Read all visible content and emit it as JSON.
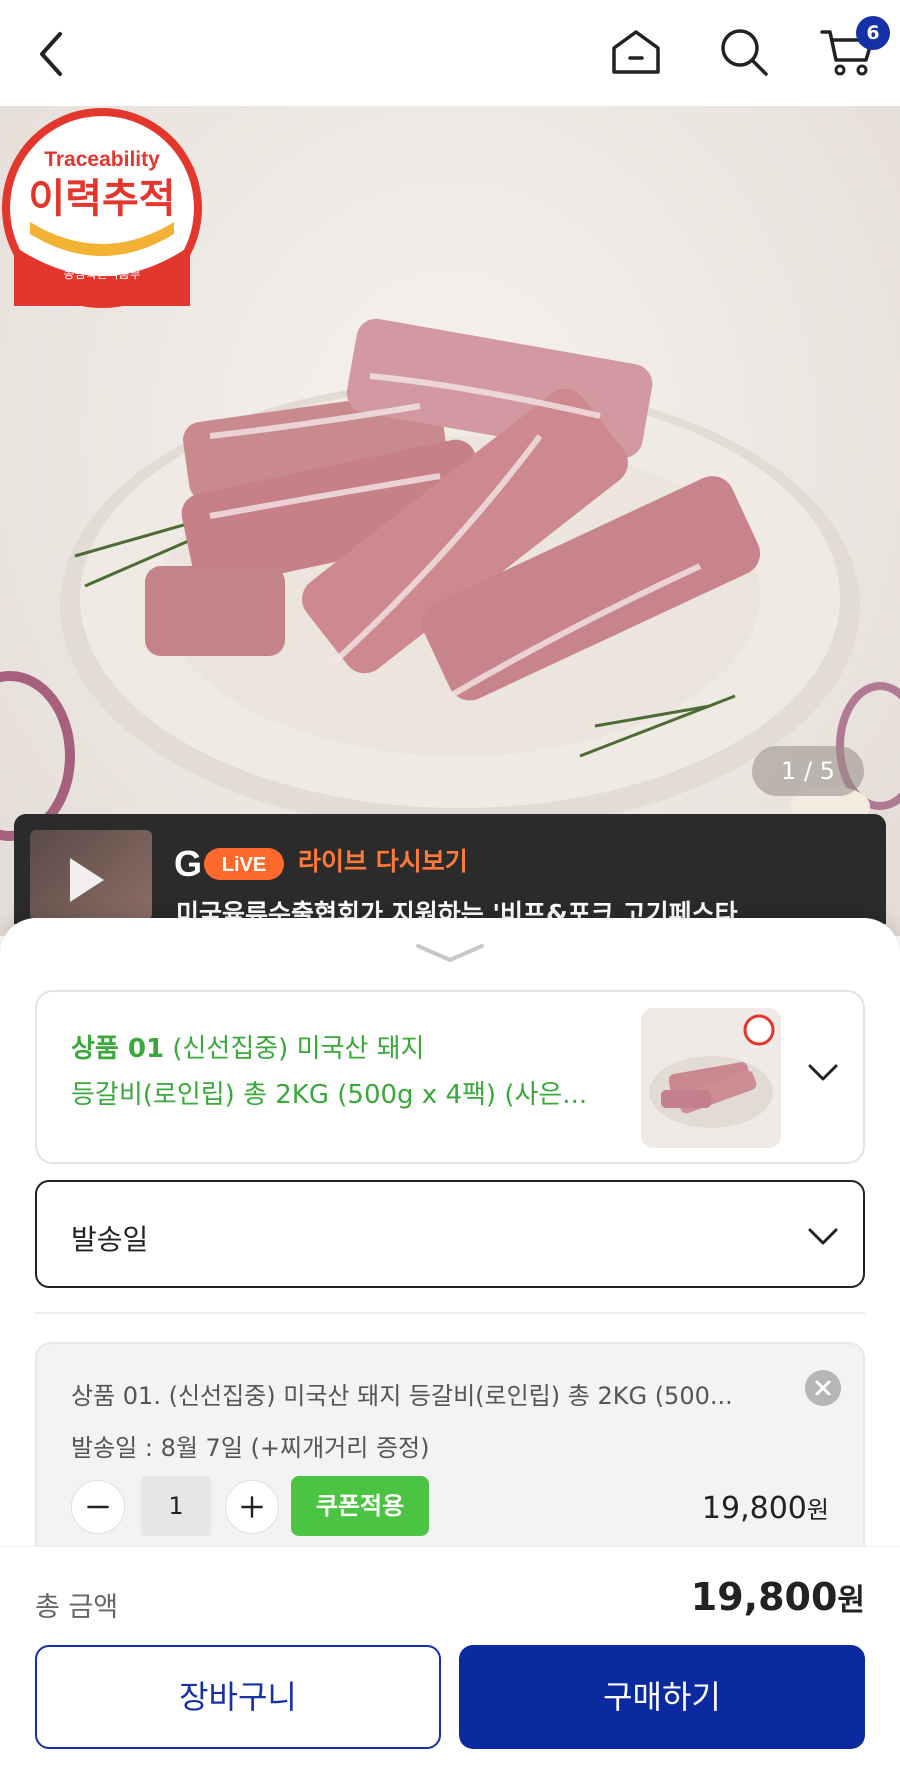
{
  "header": {
    "cart_count": "6"
  },
  "hero": {
    "counter": "1 / 5",
    "seal": {
      "top_text": "Traceability",
      "main_text": "이력추적",
      "bottom_text": "농림축산식품부"
    }
  },
  "live": {
    "badge": "LiVE",
    "title": "라이브 다시보기",
    "description": "미국육류수출협회가 지원하는 '비프&포크 고기페스타"
  },
  "product_select": {
    "number": "상품 01",
    "line1_rest": " (신선집중) 미국산 돼지",
    "line2": "등갈비(로인립) 총 2KG (500g x 4팩) (사은..."
  },
  "ship_select": {
    "label": "발송일"
  },
  "item": {
    "name": "상품 01. (신선집중) 미국산 돼지 등갈비(로인립) 총 2KG (500...",
    "ship": "발송일 : 8월 7일 (+찌개거리 증정)",
    "quantity": "1",
    "coupon": "쿠폰적용",
    "price": "19,800",
    "price_unit": "원"
  },
  "footer": {
    "total_label": "총 금액",
    "total_value": "19,800",
    "total_unit": "원",
    "cart_button": "장바구니",
    "buy_button": "구매하기"
  },
  "colors": {
    "brand_blue": "#0b2aa0",
    "green": "#4bc443",
    "live_orange": "#ff7a3a"
  }
}
